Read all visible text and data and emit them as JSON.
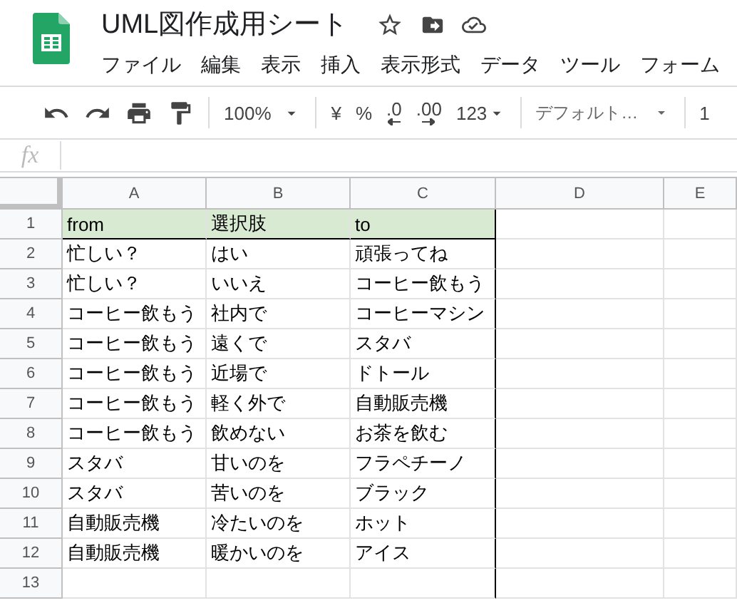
{
  "document": {
    "title": "UML図作成用シート"
  },
  "menu": [
    "ファイル",
    "編集",
    "表示",
    "挿入",
    "表示形式",
    "データ",
    "ツール",
    "フォーム"
  ],
  "toolbar": {
    "zoom": "100%",
    "currency": "¥",
    "percent": "%",
    "decimal_decrease": ".0",
    "decimal_increase": ".00",
    "number_format": "123",
    "font": "デフォルト…",
    "font_size": "1"
  },
  "formula_bar": {
    "label": "fx"
  },
  "columns": [
    "A",
    "B",
    "C",
    "D",
    "E"
  ],
  "rows": [
    {
      "number": "1",
      "highlighted": true,
      "cells": [
        "from",
        "選択肢",
        "to"
      ]
    },
    {
      "number": "2",
      "highlighted": false,
      "cells": [
        "忙しい？",
        "はい",
        "頑張ってね"
      ]
    },
    {
      "number": "3",
      "highlighted": false,
      "cells": [
        "忙しい？",
        "いいえ",
        "コーヒー飲もう"
      ]
    },
    {
      "number": "4",
      "highlighted": false,
      "cells": [
        "コーヒー飲もう",
        "社内で",
        "コーヒーマシン"
      ]
    },
    {
      "number": "5",
      "highlighted": false,
      "cells": [
        "コーヒー飲もう",
        "遠くで",
        "スタバ"
      ]
    },
    {
      "number": "6",
      "highlighted": false,
      "cells": [
        "コーヒー飲もう",
        "近場で",
        "ドトール"
      ]
    },
    {
      "number": "7",
      "highlighted": false,
      "cells": [
        "コーヒー飲もう",
        "軽く外で",
        "自動販売機"
      ]
    },
    {
      "number": "8",
      "highlighted": false,
      "cells": [
        "コーヒー飲もう",
        "飲めない",
        "お茶を飲む"
      ]
    },
    {
      "number": "9",
      "highlighted": false,
      "cells": [
        "スタバ",
        "甘いのを",
        "フラペチーノ"
      ]
    },
    {
      "number": "10",
      "highlighted": false,
      "cells": [
        "スタバ",
        "苦いのを",
        "ブラック"
      ]
    },
    {
      "number": "11",
      "highlighted": false,
      "cells": [
        "自動販売機",
        "冷たいのを",
        "ホット"
      ]
    },
    {
      "number": "12",
      "highlighted": false,
      "cells": [
        "自動販売機",
        "暖かいのを",
        "アイス"
      ]
    },
    {
      "number": "13",
      "highlighted": false,
      "cells": []
    }
  ]
}
